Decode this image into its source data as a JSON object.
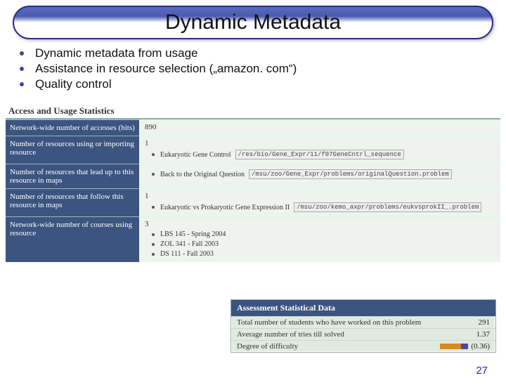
{
  "title": "Dynamic Metadata",
  "bullets": [
    "Dynamic metadata from usage",
    "Assistance in resource selection („amazon. com“)",
    "Quality control"
  ],
  "stats": {
    "heading": "Access and Usage Statistics",
    "rows": [
      {
        "label": "Network-wide number of accesses (hits)",
        "value": "890",
        "items": []
      },
      {
        "label": "Number of resources using or importing resource",
        "value": "1",
        "items": [
          {
            "text": "Eukaryotic Gene Control",
            "path": "/res/bio/Gene_Expr/11/f07GeneCntrl_sequence"
          }
        ]
      },
      {
        "label": "Number of resources that lead up to this resource in maps",
        "value": "",
        "items": [
          {
            "text": "Back to the Original Question",
            "path": "/msu/zoo/Gene_Expr/problems/originalQuestion.problem"
          }
        ]
      },
      {
        "label": "Number of resources that follow this resource in maps",
        "value": "1",
        "items": [
          {
            "text": "Eukaryotic vs Prokaryotic Gene Expression II",
            "path": "/msu/zoo/kemo_axpr/problems/eukvsprokII_.problem"
          }
        ]
      },
      {
        "label": "Network-wide number of courses using resource",
        "value": "3",
        "items": [
          {
            "text": "LBS 145 - Spring 2004",
            "path": ""
          },
          {
            "text": "ZOL 341 - Fall 2003",
            "path": ""
          },
          {
            "text": "DS 111 - Fall 2003",
            "path": ""
          }
        ]
      }
    ]
  },
  "assessment": {
    "heading": "Assessment Statistical Data",
    "rows": [
      {
        "label": "Total number of students who have worked on this problem",
        "value": "291"
      },
      {
        "label": "Average number of tries till solved",
        "value": "1.37"
      },
      {
        "label": "Degree of difficulty",
        "value": "(0.36)",
        "gauge": true
      }
    ]
  },
  "slide_number": "27"
}
